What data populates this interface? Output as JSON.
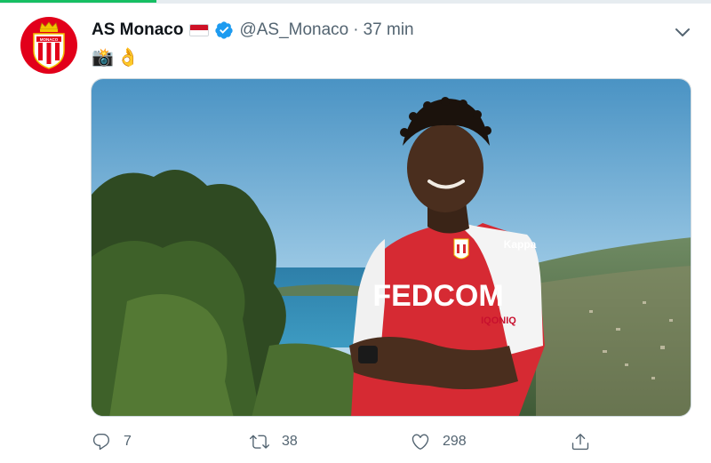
{
  "load_progress": 0.22,
  "colors": {
    "accent": "#1d9bf0",
    "brand_red": "#e2001a",
    "progress_green": "#17bf63"
  },
  "tweet": {
    "display_name": "AS Monaco",
    "handle": "@AS_Monaco",
    "separator": "·",
    "time": "37 min",
    "body_emojis": [
      "📸",
      "👌"
    ],
    "avatar_text": "MONACO",
    "flag": "monaco-flag",
    "verified": true,
    "media": {
      "description_icon": "photo",
      "shirt_text": "FEDCOM",
      "sponsor_text": "IQONIQ",
      "brand_text": "Kappa"
    },
    "actions": {
      "reply_count": "7",
      "retweet_count": "38",
      "like_count": "298"
    }
  },
  "icons": [
    "caret-down-icon",
    "reply-icon",
    "retweet-icon",
    "like-icon",
    "share-icon",
    "verified-icon"
  ]
}
